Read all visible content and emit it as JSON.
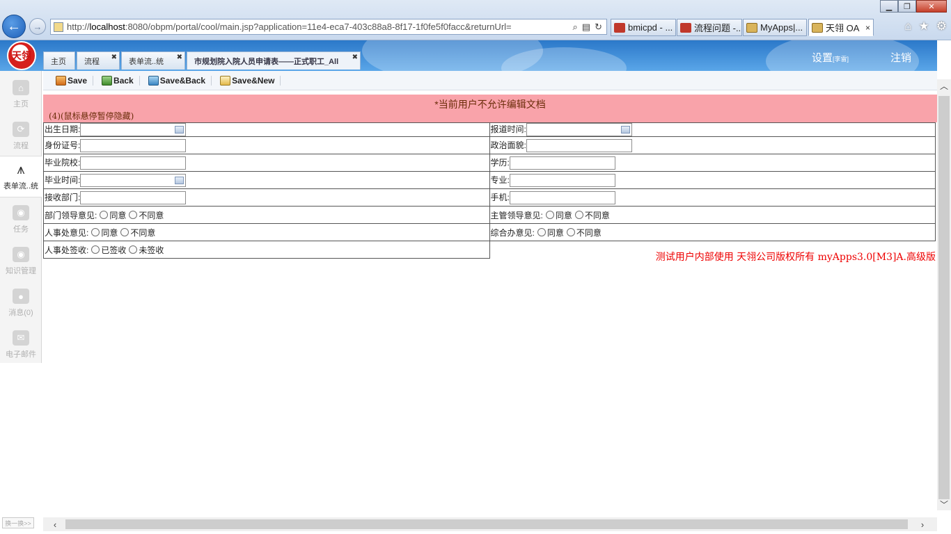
{
  "browser": {
    "url_prefix": "http://",
    "url_host": "localhost",
    "url_rest": ":8080/obpm/portal/cool/main.jsp?application=11e4-eca7-403c88a8-8f17-1f0fe5f0facc&returnUrl=",
    "tabs": [
      {
        "label": "bmicpd - ..."
      },
      {
        "label": "流程问题 -..."
      },
      {
        "label": "MyApps|..."
      },
      {
        "label": "天翎 OA",
        "close": "×"
      }
    ],
    "back_glyph": "←",
    "fwd_glyph": "→"
  },
  "app": {
    "logo_text": "天翎",
    "tabs": [
      {
        "label": "主页"
      },
      {
        "label": "流程"
      },
      {
        "label": "表单流..统"
      },
      {
        "label": "市规划院入院人员申请表——正式职工_All"
      }
    ],
    "close_glyph": "✖",
    "settings_label": "设置",
    "settings_sub": "[李雷]",
    "logout_label": "注销"
  },
  "sidebar": {
    "items": [
      {
        "label": "主页",
        "icon": "home-icon"
      },
      {
        "label": "流程",
        "icon": "flow-icon"
      },
      {
        "label": "表单流..统",
        "icon": "form-icon"
      },
      {
        "label": "任务",
        "icon": "task-icon"
      },
      {
        "label": "知识管理",
        "icon": "knowledge-icon"
      },
      {
        "label": "消息(0)",
        "icon": "message-icon"
      },
      {
        "label": "电子邮件",
        "icon": "mail-icon"
      }
    ],
    "switch_label": "换一换>>"
  },
  "toolbar": {
    "save": "Save",
    "back": "Back",
    "save_back": "Save&Back",
    "save_new": "Save&New"
  },
  "alert": {
    "message": "*当前用户不允许编辑文档",
    "hint": "(4)(鼠标悬停暂停隐藏)"
  },
  "form": {
    "birth_date": "出生日期:",
    "report_time": "报道时间:",
    "id_number": "身份证号:",
    "political": "政治面貌:",
    "school": "毕业院校:",
    "education": "学历:",
    "grad_time": "毕业时间:",
    "major": "专业:",
    "dept": "接收部门:",
    "mobile": "手机:",
    "dept_leader": "部门领导意见:",
    "chief_leader": "主管领导意见:",
    "hr_opinion": "人事处意见:",
    "office_opinion": "综合办意见:",
    "hr_receipt": "人事处签收:",
    "agree": "同意",
    "disagree": "不同意",
    "signed": "已签收",
    "unsigned": "未签收"
  },
  "footer": {
    "note": "测试用户内部使用 天翎公司版权所有 myApps3.0[M3]A.高级版"
  }
}
